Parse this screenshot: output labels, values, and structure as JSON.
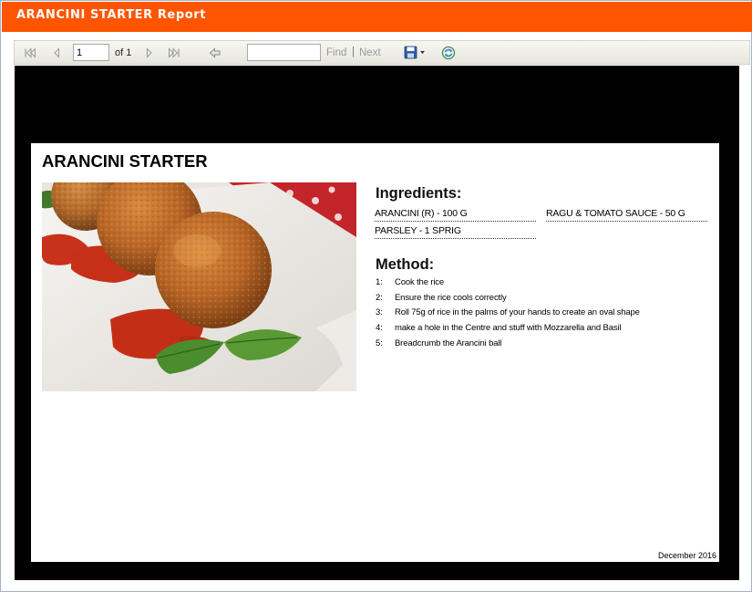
{
  "window": {
    "title": "ARANCINI STARTER Report"
  },
  "toolbar": {
    "page_value": "1",
    "page_of": "of 1",
    "find_value": "",
    "find_label": "Find",
    "separator": "|",
    "next_label": "Next"
  },
  "report": {
    "title": "ARANCINI STARTER",
    "ingredients_heading": "Ingredients:",
    "ingredients": [
      "ARANCINI (R) - 100 G",
      "RAGU & TOMATO SAUCE  - 50 G",
      "PARSLEY - 1 SPRIG"
    ],
    "method_heading": "Method:",
    "method": [
      {
        "num": "1:",
        "text": "Cook the rice"
      },
      {
        "num": "2:",
        "text": "Ensure the rice cools correctly"
      },
      {
        "num": "3:",
        "text": "Roll 75g of rice in the palms of your hands to create an oval shape"
      },
      {
        "num": "4:",
        "text": "make a hole in the Centre and stuff with Mozzarella and Basil"
      },
      {
        "num": "5:",
        "text": "Breadcrumb the Arancini ball"
      }
    ],
    "footer_date": "December 2016"
  },
  "colors": {
    "title_bar": "#ff5500",
    "viewport_bg": "#000000",
    "toolbar_bg": "#eeede6"
  }
}
